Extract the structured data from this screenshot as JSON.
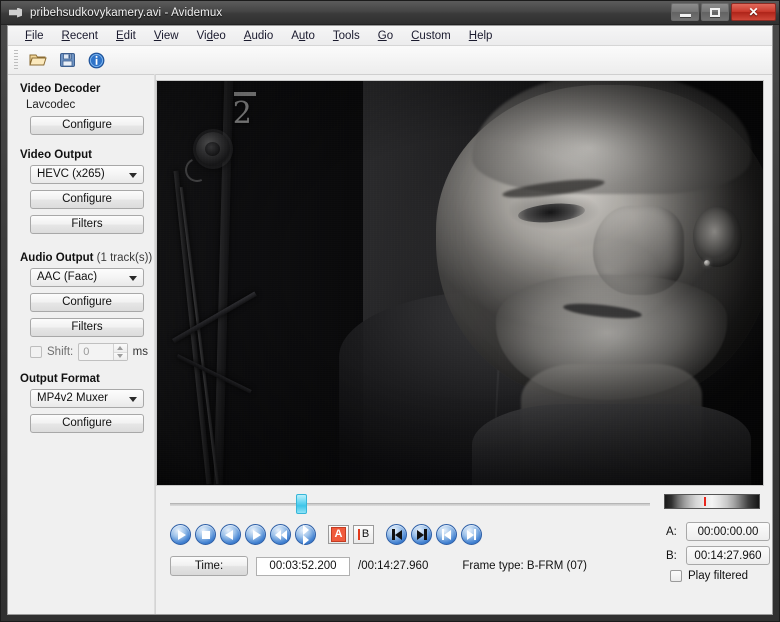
{
  "window": {
    "title": "pribehsudkovykamery.avi - Avidemux",
    "app_icon": "film-icon",
    "minimize_label": "Minimize",
    "maximize_label": "Maximize",
    "close_label": "✕"
  },
  "menubar": {
    "items": [
      {
        "label": "File",
        "accel": "F"
      },
      {
        "label": "Recent",
        "accel": "R"
      },
      {
        "label": "Edit",
        "accel": "E"
      },
      {
        "label": "View",
        "accel": "V"
      },
      {
        "label": "Video",
        "accel": "d"
      },
      {
        "label": "Audio",
        "accel": "A"
      },
      {
        "label": "Auto",
        "accel": "u"
      },
      {
        "label": "Tools",
        "accel": "T"
      },
      {
        "label": "Go",
        "accel": "G"
      },
      {
        "label": "Custom",
        "accel": "C"
      },
      {
        "label": "Help",
        "accel": "H"
      }
    ]
  },
  "toolbar": {
    "buttons": [
      {
        "name": "open-file-icon",
        "tooltip": "Open"
      },
      {
        "name": "save-file-icon",
        "tooltip": "Save"
      },
      {
        "name": "info-icon",
        "tooltip": "Information"
      }
    ]
  },
  "sidebar": {
    "video_decoder": {
      "title": "Video Decoder",
      "codec_name": "Lavcodec",
      "configure_label": "Configure"
    },
    "video_output": {
      "title": "Video Output",
      "selected": "HEVC (x265)",
      "configure_label": "Configure",
      "filters_label": "Filters"
    },
    "audio_output": {
      "title": "Audio Output",
      "track_count": "(1 track(s))",
      "selected": "AAC (Faac)",
      "configure_label": "Configure",
      "filters_label": "Filters",
      "shift_label": "Shift:",
      "shift_value": "0",
      "shift_unit": "ms",
      "shift_checked": false
    },
    "output_format": {
      "title": "Output Format",
      "selected": "MP4v2 Muxer",
      "configure_label": "Configure"
    }
  },
  "video": {
    "channel_logo": "2",
    "description": "black-and-white film frame of an elderly man"
  },
  "transport": {
    "buttons": [
      {
        "name": "play-button",
        "icon": "play-icon"
      },
      {
        "name": "stop-button",
        "icon": "stop-icon"
      },
      {
        "name": "previous-frame-button",
        "icon": "arrow-left-icon"
      },
      {
        "name": "next-frame-button",
        "icon": "arrow-right-icon"
      },
      {
        "name": "rewind-button",
        "icon": "double-arrow-left-icon"
      },
      {
        "name": "forward-button",
        "icon": "double-arrow-right-icon"
      }
    ],
    "marker_a_label": "A",
    "marker_b_label": "B",
    "nav_buttons": [
      {
        "name": "goto-marker-a-button",
        "icon": "bar-left-icon"
      },
      {
        "name": "goto-marker-b-button",
        "icon": "bar-right-icon"
      },
      {
        "name": "goto-start-button",
        "icon": "skip-start-icon"
      },
      {
        "name": "goto-end-button",
        "icon": "skip-end-icon"
      }
    ]
  },
  "status": {
    "time_button_label": "Time:",
    "current_time": "00:03:52.200",
    "total_time": "/00:14:27.960",
    "frame_type_label": "Frame type:",
    "frame_type_value": "B-FRM (07)"
  },
  "markers": {
    "a_label": "A:",
    "a_value": "00:00:00.00",
    "b_label": "B:",
    "b_value": "00:14:27.960",
    "play_filtered_label": "Play filtered",
    "play_filtered_checked": false
  },
  "audio_panel": {
    "volume_icon": "speaker-icon",
    "vu_meter": "audio-level-meter"
  },
  "colors": {
    "accent": "#3f7fd0",
    "marker_red": "#e8261c",
    "slider_cyan": "#3ec5e8",
    "window_bg": "#f0f0f0",
    "titlebar": "#3a3a3a"
  }
}
